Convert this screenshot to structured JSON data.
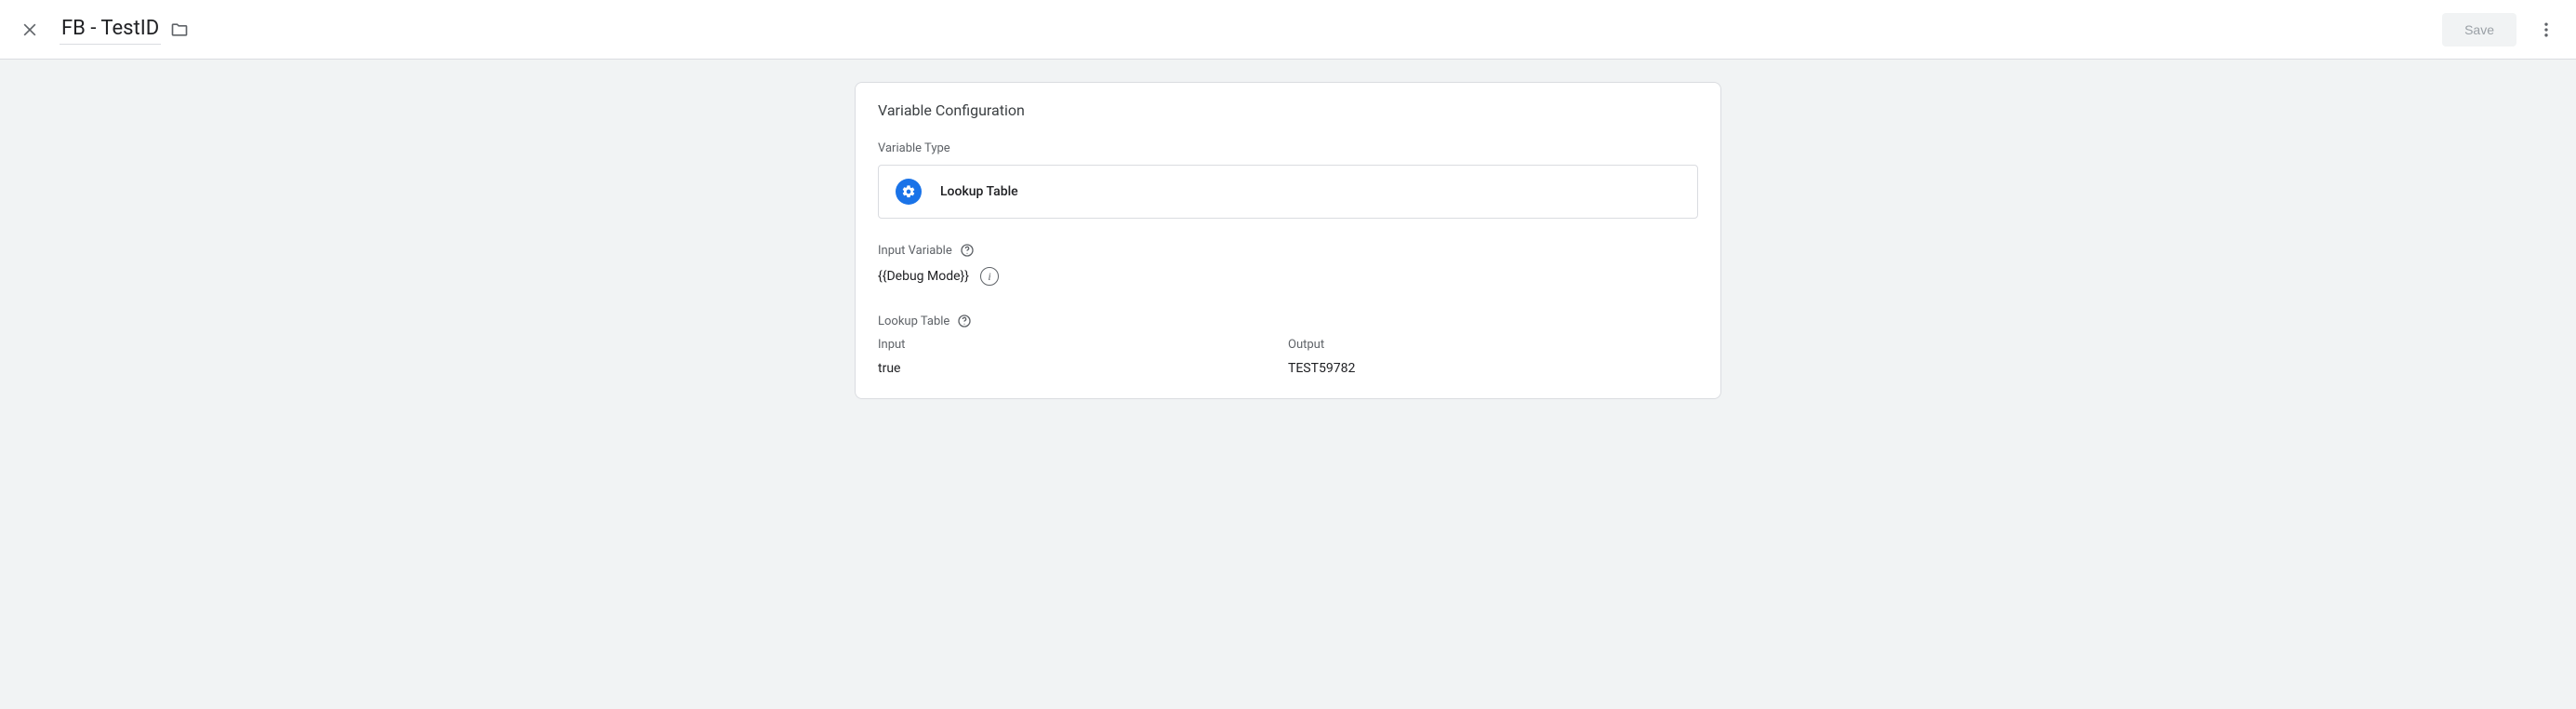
{
  "header": {
    "title": "FB - TestID",
    "save_label": "Save"
  },
  "card": {
    "title": "Variable Configuration",
    "variable_type_label": "Variable Type",
    "variable_type_name": "Lookup Table",
    "input_variable_label": "Input Variable",
    "input_variable_value": "{{Debug Mode}}",
    "lookup_table_label": "Lookup Table",
    "table": {
      "input_header": "Input",
      "output_header": "Output",
      "rows": [
        {
          "input": "true",
          "output": "TEST59782"
        }
      ]
    }
  }
}
